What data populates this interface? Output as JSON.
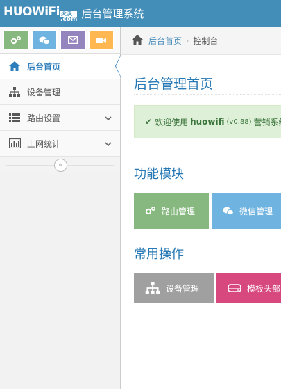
{
  "header": {
    "logo_text": "HUOWiFi",
    "logo_sub_cn": "火沃",
    "logo_sub_com": ".com",
    "title": "后台管理系统",
    "bg_color": "#438eb9"
  },
  "shortcuts": [
    {
      "icon": "gears-icon",
      "color": "#87b87f"
    },
    {
      "icon": "wechat-icon",
      "color": "#6fb3e0"
    },
    {
      "icon": "envelope-icon",
      "color": "#9585bf"
    },
    {
      "icon": "video-icon",
      "color": "#ffb752"
    }
  ],
  "sidebar": {
    "items": [
      {
        "label": "后台首页",
        "icon": "home-icon",
        "active": true
      },
      {
        "label": "设备管理",
        "icon": "sitemap-icon",
        "active": false
      },
      {
        "label": "路由设置",
        "icon": "list-icon",
        "active": false,
        "has_submenu": true
      },
      {
        "label": "上网统计",
        "icon": "bar-chart-icon",
        "active": false,
        "has_submenu": true
      }
    ],
    "collapse_glyph": "«"
  },
  "breadcrumbs": {
    "home_label": "后台首页",
    "separator": "›",
    "current": "控制台"
  },
  "main": {
    "page_title": "后台管理首页",
    "alert": {
      "prefix": "欢迎使用",
      "brand": "huowifi",
      "version": "(v0.88)",
      "suffix": "营销系统"
    },
    "section_modules": "功能模块",
    "module_tiles": [
      {
        "label": "路由管理",
        "icon": "gears-icon",
        "color": "#87b87f"
      },
      {
        "label": "微信管理",
        "icon": "wechat-icon",
        "color": "#6fb3e0"
      }
    ],
    "section_ops": "常用操作",
    "op_tiles": [
      {
        "label": "设备管理",
        "icon": "sitemap-icon",
        "color": "#a0a0a0"
      },
      {
        "label": "模板头部",
        "icon": "hdd-icon",
        "color": "#d6487e"
      }
    ]
  }
}
